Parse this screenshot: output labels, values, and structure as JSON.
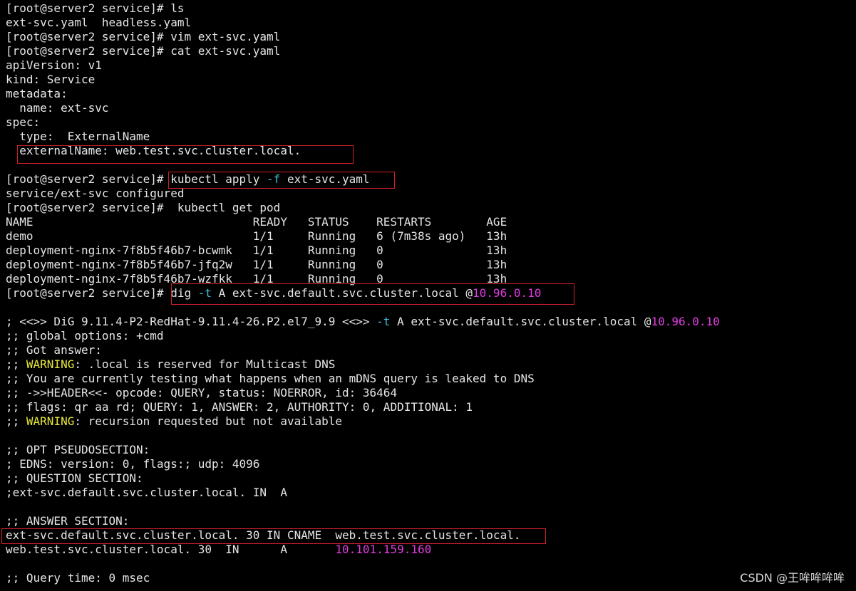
{
  "colors": {
    "background": "#000000",
    "text": "#e6e6e6",
    "cyan": "#3ec1d3",
    "magenta": "#e03ce0",
    "yellow": "#e6e63c",
    "highlight_border": "#d0202a"
  },
  "lines": [
    [
      {
        "t": "[root@server2 service]# ls"
      }
    ],
    [
      {
        "t": "ext-svc.yaml  headless.yaml"
      }
    ],
    [
      {
        "t": "[root@server2 service]# vim ext-svc.yaml"
      }
    ],
    [
      {
        "t": "[root@server2 service]# cat ext-svc.yaml"
      }
    ],
    [
      {
        "t": "apiVersion: v1"
      }
    ],
    [
      {
        "t": "kind: Service"
      }
    ],
    [
      {
        "t": "metadata:"
      }
    ],
    [
      {
        "t": "  name: ext-svc"
      }
    ],
    [
      {
        "t": "spec:"
      }
    ],
    [
      {
        "t": "  type:  ExternalName"
      }
    ],
    [
      {
        "t": "  externalName: web.test.svc.cluster.local."
      }
    ],
    [
      {
        "t": ""
      }
    ],
    [
      {
        "t": "[root@server2 service]# kubectl apply "
      },
      {
        "t": "-f",
        "c": "cyan"
      },
      {
        "t": " ext-svc.yaml"
      }
    ],
    [
      {
        "t": "service/ext-svc configured"
      }
    ],
    [
      {
        "t": "[root@server2 service]#  kubectl get pod"
      }
    ],
    [
      {
        "t": "NAME                                READY   STATUS    RESTARTS        AGE"
      }
    ],
    [
      {
        "t": "demo                                1/1     Running   6 (7m38s ago)   13h"
      }
    ],
    [
      {
        "t": "deployment-nginx-7f8b5f46b7-bcwmk   1/1     Running   0               13h"
      }
    ],
    [
      {
        "t": "deployment-nginx-7f8b5f46b7-jfq2w   1/1     Running   0               13h"
      }
    ],
    [
      {
        "t": "deployment-nginx-7f8b5f46b7-wzfkk   1/1     Running   0               13h"
      }
    ],
    [
      {
        "t": "[root@server2 service]# dig "
      },
      {
        "t": "-t",
        "c": "cyan"
      },
      {
        "t": " A ext-svc.default.svc.cluster.local @"
      },
      {
        "t": "10.96.0.10",
        "c": "magenta"
      }
    ],
    [
      {
        "t": ""
      }
    ],
    [
      {
        "t": "; <<>> DiG 9.11.4-P2-RedHat-9.11.4-26.P2.el7_9.9 <<>> "
      },
      {
        "t": "-t",
        "c": "cyan"
      },
      {
        "t": " A ext-svc.default.svc.cluster.local @"
      },
      {
        "t": "10.96.0.10",
        "c": "magenta"
      }
    ],
    [
      {
        "t": ";; global options: +cmd"
      }
    ],
    [
      {
        "t": ";; Got answer:"
      }
    ],
    [
      {
        "t": ";; "
      },
      {
        "t": "WARNING",
        "c": "yellow"
      },
      {
        "t": ": .local is reserved for Multicast DNS"
      }
    ],
    [
      {
        "t": ";; You are currently testing what happens when an mDNS query is leaked to DNS"
      }
    ],
    [
      {
        "t": ";; ->>HEADER<<- opcode: QUERY, status: NOERROR, id: 36464"
      }
    ],
    [
      {
        "t": ";; flags: qr aa rd; QUERY: 1, ANSWER: 2, AUTHORITY: 0, ADDITIONAL: 1"
      }
    ],
    [
      {
        "t": ";; "
      },
      {
        "t": "WARNING",
        "c": "yellow"
      },
      {
        "t": ": recursion requested but not available"
      }
    ],
    [
      {
        "t": ""
      }
    ],
    [
      {
        "t": ";; OPT PSEUDOSECTION:"
      }
    ],
    [
      {
        "t": "; EDNS: version: 0, flags:; udp: 4096"
      }
    ],
    [
      {
        "t": ";; QUESTION SECTION:"
      }
    ],
    [
      {
        "t": ";ext-svc.default.svc.cluster.local. IN  A"
      }
    ],
    [
      {
        "t": ""
      }
    ],
    [
      {
        "t": ";; ANSWER SECTION:"
      }
    ],
    [
      {
        "t": "ext-svc.default.svc.cluster.local. 30 IN CNAME  web.test.svc.cluster.local."
      }
    ],
    [
      {
        "t": "web.test.svc.cluster.local. 30  IN      A       "
      },
      {
        "t": "10.101.159.160",
        "c": "magenta"
      }
    ],
    [
      {
        "t": ""
      }
    ],
    [
      {
        "t": ";; Query time: 0 msec"
      }
    ]
  ],
  "watermark": "CSDN @王哞哞哞哞"
}
